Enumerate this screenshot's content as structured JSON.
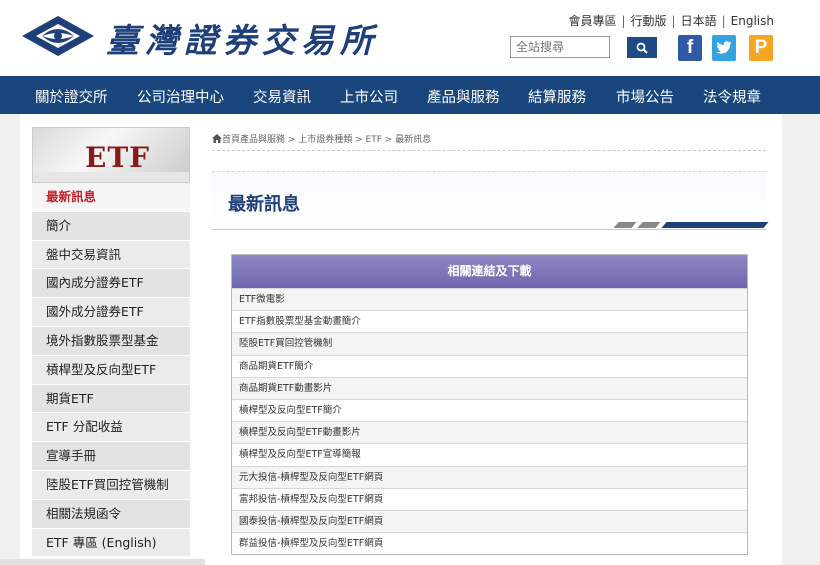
{
  "header": {
    "logo_text": "臺灣證券交易所",
    "toplinks": [
      "會員專區",
      "行動版",
      "日本語",
      "English"
    ],
    "search_placeholder": "全站搜尋",
    "social": {
      "facebook": "f",
      "twitter": "t",
      "plurk": "P"
    }
  },
  "nav": {
    "items": [
      "關於證交所",
      "公司治理中心",
      "交易資訊",
      "上市公司",
      "產品與服務",
      "結算服務",
      "市場公告",
      "法令規章"
    ]
  },
  "sidebar": {
    "banner_text": "ETF",
    "items": [
      "最新訊息",
      "簡介",
      "盤中交易資訊",
      "國內成分證券ETF",
      "國外成分證券ETF",
      "境外指數股票型基金",
      "槓桿型及反向型ETF",
      "期貨ETF",
      "ETF 分配收益",
      "宣導手冊",
      "陸股ETF買回控管機制",
      "相關法規函令",
      "ETF 專區 (English)"
    ]
  },
  "breadcrumb": "首頁產品與服務 > 上市證券種類 > ETF > 最新訊息",
  "main": {
    "title": "最新訊息",
    "links_header": "相關連結及下載",
    "links": [
      "ETF微電影",
      "ETF指數股票型基金動畫簡介",
      "陸股ETF買回控管機制",
      "商品期貨ETF簡介",
      "商品期貨ETF動畫影片",
      "槓桿型及反向型ETF簡介",
      "槓桿型及反向型ETF動畫影片",
      "槓桿型及反向型ETF宣導簡報",
      "元大投信-槓桿型及反向型ETF網頁",
      "富邦投信-槓桿型及反向型ETF網頁",
      "國泰投信-槓桿型及反向型ETF網頁",
      "群益投信-槓桿型及反向型ETF網頁"
    ]
  },
  "colors": {
    "brand_blue": "#1a467e",
    "active_red": "#c4202a",
    "table_header_purple": "#7a74b8"
  }
}
